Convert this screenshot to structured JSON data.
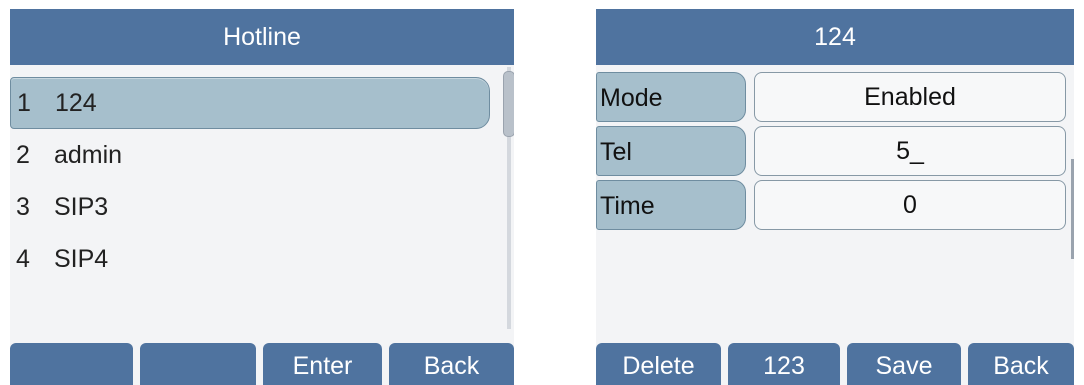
{
  "hotline_screen": {
    "title": "Hotline",
    "items": [
      {
        "index": "1",
        "label": "124",
        "selected": true
      },
      {
        "index": "2",
        "label": "admin"
      },
      {
        "index": "3",
        "label": "SIP3"
      },
      {
        "index": "4",
        "label": "SIP4"
      }
    ],
    "softkeys": [
      "",
      "",
      "Enter",
      "Back"
    ]
  },
  "account_screen": {
    "title": "124",
    "fields": [
      {
        "label": "Mode",
        "value": "Enabled"
      },
      {
        "label": "Tel",
        "value": "5_"
      },
      {
        "label": "Time",
        "value": "0"
      }
    ],
    "softkeys": [
      "Delete",
      "123",
      "Save",
      "Back"
    ]
  },
  "colors": {
    "titlebar": "#4f739f",
    "selection": "#a6bfcc",
    "background": "#f3f4f6"
  }
}
